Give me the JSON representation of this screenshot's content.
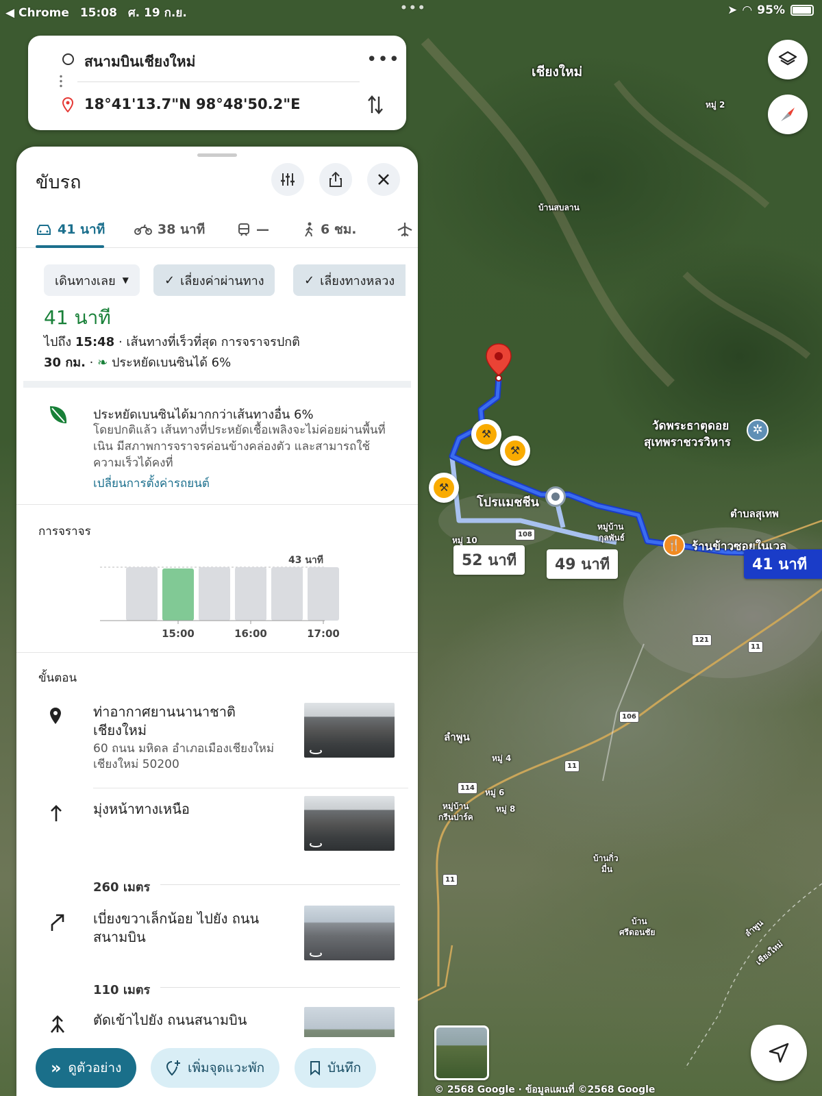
{
  "status_bar": {
    "app": "◀ Chrome",
    "time": "15:08",
    "date": "ศ. 19 ก.ย.",
    "battery": "95%"
  },
  "search": {
    "origin": "สนามบินเชียงใหม่",
    "destination": "18°41'13.7\"N 98°48'50.2\"E"
  },
  "panel": {
    "title": "ขับรถ",
    "tabs": [
      {
        "mode": "drive",
        "icon": "car-icon",
        "label": "41 นาที"
      },
      {
        "mode": "motorbike",
        "icon": "motorbike-icon",
        "label": "38 นาที"
      },
      {
        "mode": "transit",
        "icon": "train-icon",
        "label": "—"
      },
      {
        "mode": "walk",
        "icon": "walk-icon",
        "label": "6 ชม."
      },
      {
        "mode": "flight",
        "icon": "plane-icon",
        "label": ""
      }
    ],
    "chips": {
      "depart": "เดินทางเลย",
      "avoid_tolls": "เลี่ยงค่าผ่านทาง",
      "avoid_highways": "เลี่ยงทางหลวง"
    },
    "summary": {
      "duration": "41 นาที",
      "arrive_prefix": "ไปถึง",
      "arrive_time": "15:48",
      "arrive_suffix": " · เส้นทางที่เร็วที่สุด การจราจรปกติ",
      "distance": "30 กม.",
      "distance_suffix": " · ",
      "fuel_saving": "ประหยัดเบนซินได้ 6%"
    },
    "eco": {
      "title": "ประหยัดเบนซินได้มากกว่าเส้นทางอื่น 6%",
      "body": "โดยปกติแล้ว เส้นทางที่ประหยัดเชื้อเพลิงจะไม่ค่อยผ่านพื้นที่เนิน มีสภาพการจราจรค่อนข้างคล่องตัว และสามารถใช้ความเร็วได้คงที่",
      "link": "เปลี่ยนการตั้งค่ารถยนต์"
    },
    "traffic": {
      "title": "การจราจร",
      "peak_label": "43 นาที"
    },
    "steps_title": "ขั้นตอน",
    "steps": [
      {
        "icon": "place-pin-icon",
        "title": "ท่าอากาศยานนานาชาติเชียงใหม่",
        "subtitle": "60 ถนน มหิดล อำเภอเมืองเชียงใหม่ เชียงใหม่ 50200"
      },
      {
        "icon": "arrow-up-icon",
        "title": "มุ่งหน้าทางเหนือ",
        "distance": "260 เมตร"
      },
      {
        "icon": "slight-right-icon",
        "title": "เบี่ยงขวาเล็กน้อย ไปยัง ถนนสนามบิน",
        "distance": "110 เมตร"
      },
      {
        "icon": "merge-icon",
        "title": "ตัดเข้าไปยัง ถนนสนามบิน"
      }
    ],
    "actions": {
      "preview": "ดูตัวอย่าง",
      "add_stop": "เพิ่มจุดแวะพัก",
      "save": "บันทึก"
    }
  },
  "map": {
    "labels": {
      "city_north": "เชียงใหม่",
      "moo2": "หมู่ 2",
      "ban_sob_lan": "บ้านสบลาน",
      "temple_line1": "วัดพระธาตุดอย",
      "temple_line2": "สุเทพราชวรวิหาร",
      "tambon_suthep": "ตำบลสุเทพ",
      "promenada": "โปรแมชชีน",
      "moo10": "หมู่ 10",
      "moo_ban_kulphan_1": "หมู่บ้าน",
      "moo_ban_kulphan_2": "กุลพันธ์",
      "restaurant": "ร้านข้าวซอยในเวล",
      "lamphun": "ลำพูน",
      "moo4": "หมู่ 4",
      "moo6": "หมู่ 6",
      "moo8": "หมู่ 8",
      "moo_ban_green_1": "หมู่บ้าน",
      "moo_ban_green_2": "กรีนปาร์ค",
      "ban_kio_1": "บ้านกิ่ว",
      "ban_kio_2": "มื่น",
      "ban_sri_1": "บ้าน",
      "ban_sri_2": "ศรีดอนชัย",
      "lamphun_diag": "ลำพูน",
      "chiangmai_diag": "เชียงใหม่"
    },
    "route_shields": [
      "108",
      "121",
      "11",
      "106",
      "11",
      "114",
      "11"
    ],
    "route_badges": {
      "alt1": "52 นาที",
      "alt2": "49 นาที",
      "main": "41 นาที"
    },
    "copyright": "© 2568 Google · ข้อมูลแผนที่ ©2568 Google"
  },
  "colors": {
    "accent": "#1b6f8d",
    "route_main": "#1a3cc8",
    "route_alt": "#a8c1ef",
    "duration_green": "#188038",
    "traffic_now": "#81c995",
    "traffic_other": "#dadce0"
  },
  "chart_data": {
    "type": "bar",
    "categories": [
      "",
      "15:00",
      "",
      "16:00",
      "",
      "17:00"
    ],
    "x_tick_labels": [
      "15:00",
      "16:00",
      "17:00"
    ],
    "values": [
      43,
      42,
      43,
      43,
      43,
      43
    ],
    "highlight_index": 1,
    "annotation": "43 นาที",
    "ylim": [
      0,
      43
    ]
  }
}
